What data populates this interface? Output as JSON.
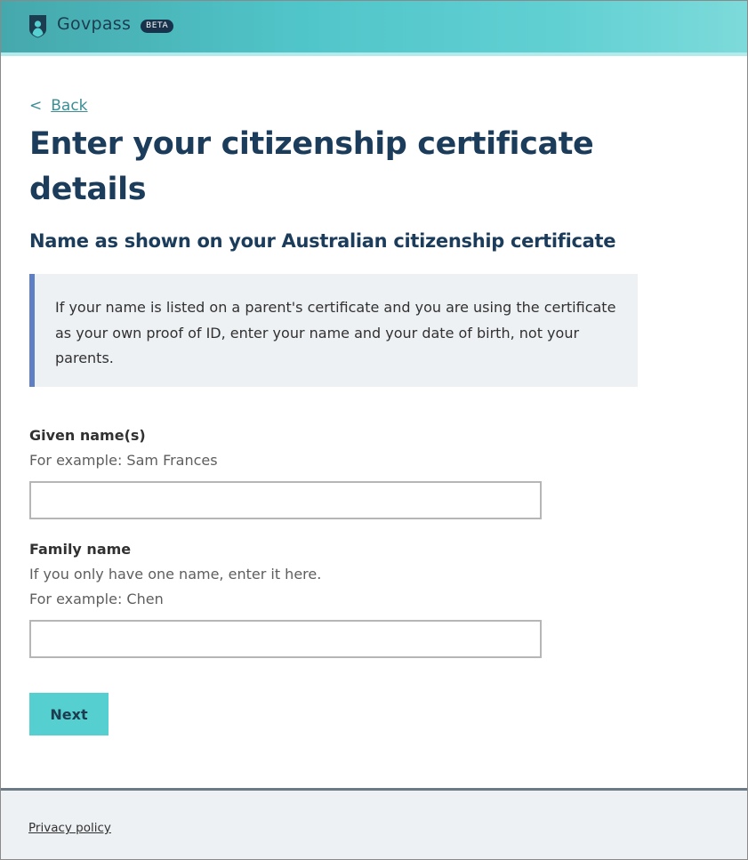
{
  "header": {
    "brand": "Govpass",
    "badge": "BETA",
    "logo_icon": "shield-icon"
  },
  "nav": {
    "back_chevron": "<",
    "back_label": "Back"
  },
  "page": {
    "title": "Enter your citizenship certificate details",
    "subtitle": "Name as shown on your Australian citizenship certificate",
    "callout": "If your name is listed on a parent's certificate and you are using the certificate as your own proof of ID, enter your name and your date of birth, not your parents."
  },
  "form": {
    "given_name": {
      "label": "Given name(s)",
      "hint": "For example: Sam Frances",
      "value": ""
    },
    "family_name": {
      "label": "Family name",
      "hint_1": "If you only have one name, enter it here.",
      "hint_2": "For example: Chen",
      "value": ""
    },
    "next_label": "Next"
  },
  "footer": {
    "privacy_label": "Privacy policy"
  },
  "colors": {
    "header_start": "#45a8ac",
    "header_end": "#7ddada",
    "heading": "#1c3c5b",
    "link": "#3a8f94",
    "callout_border": "#5f7fc4",
    "callout_bg": "#eef1f4",
    "button": "#55cfd0"
  }
}
